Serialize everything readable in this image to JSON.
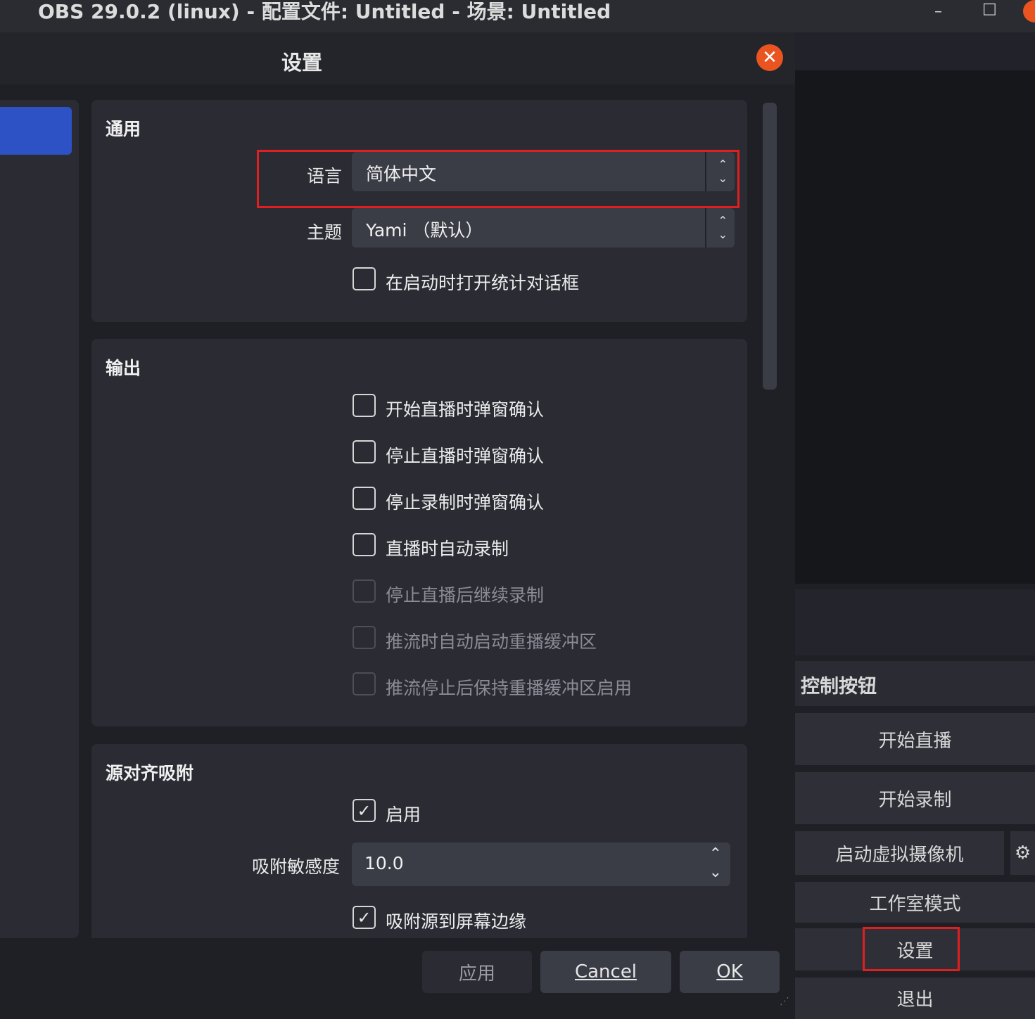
{
  "window": {
    "title": "OBS 29.0.2 (linux) - 配置文件: Untitled - 场景: Untitled",
    "minimize_glyph": "–",
    "maximize_glyph": "□"
  },
  "dialog": {
    "title": "设置",
    "close_glyph": "✕",
    "sections": {
      "general": {
        "title": "通用",
        "language_label": "语言",
        "language_value": "简体中文",
        "theme_label": "主题",
        "theme_value": "Yami （默认）",
        "open_stats_on_start": "在启动时打开统计对话框"
      },
      "output": {
        "title": "输出",
        "items": [
          {
            "label": "开始直播时弹窗确认",
            "checked": false,
            "enabled": true
          },
          {
            "label": "停止直播时弹窗确认",
            "checked": false,
            "enabled": true
          },
          {
            "label": "停止录制时弹窗确认",
            "checked": false,
            "enabled": true
          },
          {
            "label": "直播时自动录制",
            "checked": false,
            "enabled": true
          },
          {
            "label": "停止直播后继续录制",
            "checked": false,
            "enabled": false
          },
          {
            "label": "推流时自动启动重播缓冲区",
            "checked": false,
            "enabled": false
          },
          {
            "label": "推流停止后保持重播缓冲区启用",
            "checked": false,
            "enabled": false
          }
        ]
      },
      "snapping": {
        "title": "源对齐吸附",
        "enable_label": "启用",
        "sensitivity_label": "吸附敏感度",
        "sensitivity_value": "10.0",
        "snap_screen_edges": "吸附源到屏幕边缘"
      }
    },
    "footer": {
      "apply": "应用",
      "cancel": "Cancel",
      "ok": "OK"
    }
  },
  "main_controls": {
    "header": "控制按钮",
    "buttons": [
      "开始直播",
      "开始录制",
      "启动虚拟摄像机",
      "工作室模式",
      "设置",
      "退出"
    ]
  },
  "highlight_color": "#e02020",
  "accent_color": "#2d52c5"
}
